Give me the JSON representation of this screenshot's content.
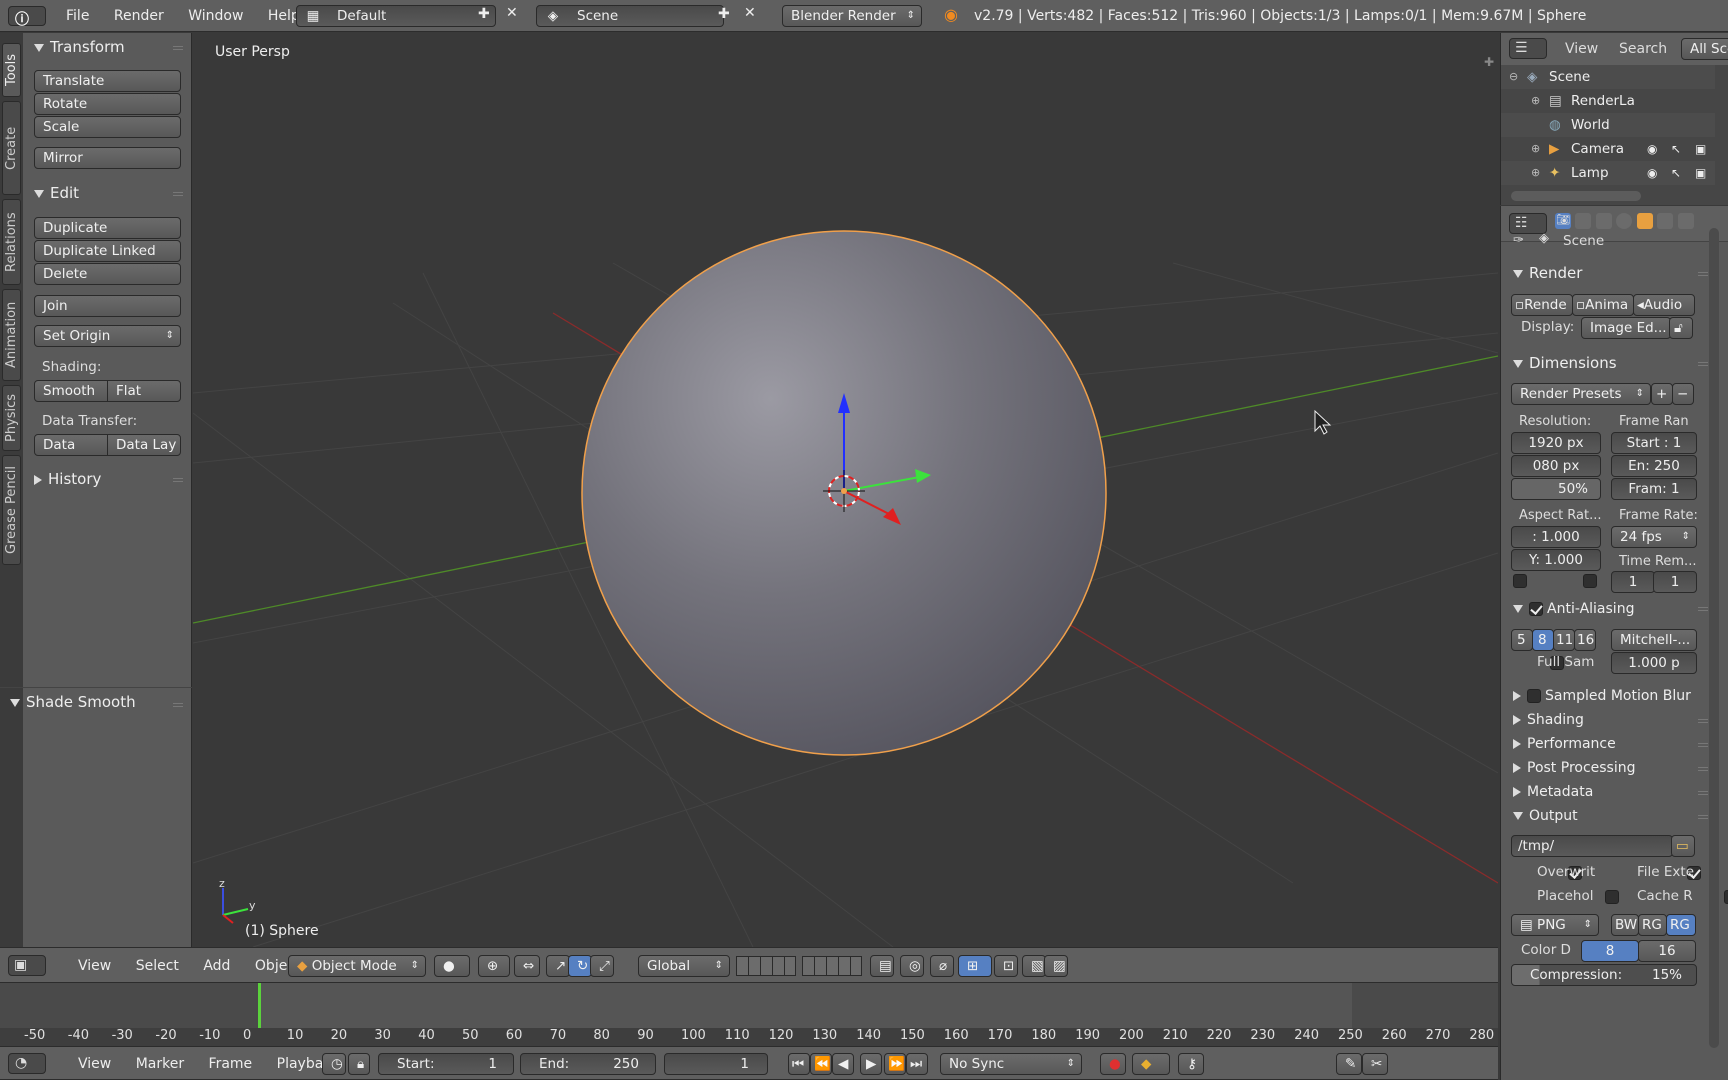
{
  "top_bar": {
    "menus": [
      "File",
      "Render",
      "Window",
      "Help"
    ],
    "screen_layout": "Default",
    "scene_name": "Scene",
    "render_engine": "Blender Render",
    "stats": "v2.79 | Verts:482 | Faces:512 | Tris:960 | Objects:1/3 | Lamps:0/1 | Mem:9.67M | Sphere"
  },
  "toolshelf": {
    "tabs": [
      "Tools",
      "Create",
      "Relations",
      "Animation",
      "Physics",
      "Grease Pencil"
    ],
    "transform": {
      "title": "Transform",
      "buttons": [
        "Translate",
        "Rotate",
        "Scale"
      ],
      "mirror": "Mirror"
    },
    "edit": {
      "title": "Edit",
      "buttons": [
        "Duplicate",
        "Duplicate Linked",
        "Delete"
      ],
      "join": "Join",
      "set_origin": "Set Origin",
      "shading_label": "Shading:",
      "smooth": "Smooth",
      "flat": "Flat",
      "data_transfer_label": "Data Transfer:",
      "data": "Data",
      "data_lay": "Data Lay"
    },
    "history": "History",
    "last_op": "Shade Smooth"
  },
  "viewport": {
    "view_label": "User Persp",
    "object_label": "(1) Sphere",
    "axis_x": "y",
    "axis_z": "z"
  },
  "viewport_header": {
    "menus": [
      "View",
      "Select",
      "Add",
      "Object"
    ],
    "mode": "Object Mode",
    "orientation": "Global"
  },
  "timeline": {
    "ticks": [
      "-50",
      "-40",
      "-30",
      "-20",
      "-10",
      "0",
      "10",
      "20",
      "30",
      "40",
      "50",
      "60",
      "70",
      "80",
      "90",
      "100",
      "110",
      "120",
      "130",
      "140",
      "150",
      "160",
      "170",
      "180",
      "190",
      "200",
      "210",
      "220",
      "230",
      "240",
      "250",
      "260",
      "270",
      "280"
    ],
    "menus": [
      "View",
      "Marker",
      "Frame",
      "Playback"
    ],
    "start_label": "Start:",
    "start_value": "1",
    "end_label": "End:",
    "end_value": "250",
    "current_frame": "1",
    "sync": "No Sync"
  },
  "outliner": {
    "menus": [
      "View",
      "Search"
    ],
    "filter": "All Sce",
    "items": [
      {
        "name": "Scene",
        "indent": 0
      },
      {
        "name": "RenderLa",
        "indent": 1
      },
      {
        "name": "World",
        "indent": 1
      },
      {
        "name": "Camera",
        "indent": 1
      },
      {
        "name": "Lamp",
        "indent": 1
      }
    ]
  },
  "properties": {
    "context": "Scene",
    "render": {
      "title": "Render",
      "buttons": [
        "Rende",
        "Anima",
        "Audio"
      ],
      "display_label": "Display:",
      "display_value": "Image Ed..."
    },
    "dimensions": {
      "title": "Dimensions",
      "presets": "Render Presets",
      "resolution_label": "Resolution:",
      "res_x": "1920 px",
      "res_y": "080 px",
      "res_pct": "50%",
      "frame_range_label": "Frame Ran",
      "start": "Start : 1",
      "end": "En: 250",
      "frame": "Fram: 1",
      "aspect_label": "Aspect Rat...",
      "aspect_x": ":  1.000",
      "aspect_y": "Y: 1.000",
      "frame_rate_label": "Frame Rate:",
      "frame_rate": "24 fps",
      "time_rem_label": "Time Rem...",
      "time_a": "1",
      "time_b": "1"
    },
    "anti_aliasing": {
      "title": "Anti-Aliasing",
      "samples": [
        "5",
        "8",
        "11",
        "16"
      ],
      "active_sample": "8",
      "filter": "Mitchell-...",
      "full_sample": "Full Sam",
      "filter_size": "1.000 p"
    },
    "collapsed_panels": [
      "Sampled Motion Blur",
      "Shading",
      "Performance",
      "Post Processing",
      "Metadata"
    ],
    "output": {
      "title": "Output",
      "path": "/tmp/",
      "overwrite": "Overwrit",
      "file_ext": "File Exte",
      "placeholders": "Placehol",
      "cache": "Cache R",
      "format": "PNG",
      "bw": "BW",
      "rgb": "RG",
      "rgba": "RG",
      "color_depth_label": "Color D",
      "depth_8": "8",
      "depth_16": "16",
      "compression": "Compression:",
      "compression_value": "15%"
    }
  },
  "colors": {
    "accent": "#5680c2",
    "selection_outline": "#f0a04b",
    "x_axis": "#8a2b2b",
    "y_axis": "#4e8a28"
  }
}
